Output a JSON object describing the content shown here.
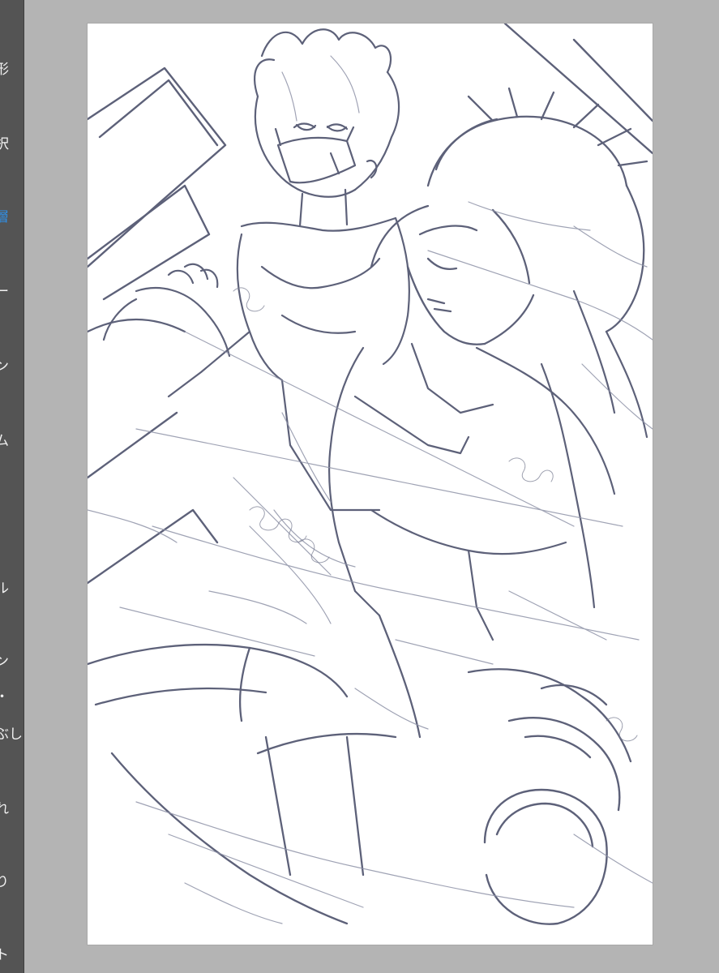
{
  "tool_palette": {
    "items": [
      {
        "label": "形",
        "active": false
      },
      {
        "label": "択",
        "active": false
      },
      {
        "label": "層",
        "active": true
      },
      {
        "label": "ー",
        "active": false
      },
      {
        "label": "ン",
        "active": false
      },
      {
        "label": "ム",
        "active": false
      },
      {
        "label": "ル",
        "active": false
      },
      {
        "label": "ン",
        "active": false
      },
      {
        "label": "・",
        "active": false
      },
      {
        "label": "ぶし",
        "active": false
      },
      {
        "label": "れ",
        "active": false
      },
      {
        "label": "り",
        "active": false
      },
      {
        "label": "ト",
        "active": false
      }
    ]
  },
  "canvas": {
    "background": "#ffffff",
    "stroke_color": "#5d6179",
    "stroke_color_light": "#8f93a8",
    "content": "sketch-artwork"
  },
  "workspace": {
    "background": "#b4b4b4",
    "palette_background": "#545454",
    "accent": "#2f8fe6"
  }
}
